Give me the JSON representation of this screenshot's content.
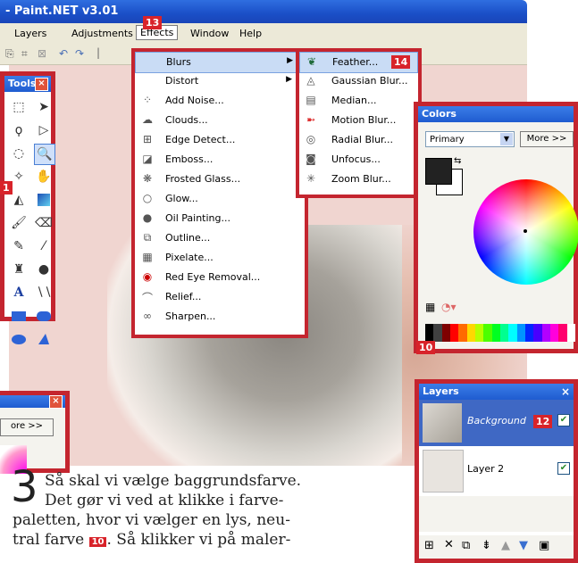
{
  "window": {
    "title": "- Paint.NET v3.01"
  },
  "menubar": {
    "layers": "Layers",
    "adjustments": "Adjustments",
    "effects": "Effects",
    "window": "Window",
    "help": "Help"
  },
  "badges": {
    "effects": "13",
    "feather": "14",
    "tools": "1",
    "colors": "10",
    "layers": "12",
    "inline": "10"
  },
  "tools": {
    "title": "Tools"
  },
  "effects_menu": {
    "items": [
      {
        "label": "Blurs",
        "icon": "blurs-icon",
        "submenu": true
      },
      {
        "label": "Distort",
        "icon": "",
        "submenu": true
      },
      {
        "label": "Add Noise...",
        "icon": "noise-icon"
      },
      {
        "label": "Clouds...",
        "icon": "clouds-icon"
      },
      {
        "label": "Edge Detect...",
        "icon": "edge-detect-icon"
      },
      {
        "label": "Emboss...",
        "icon": "emboss-icon"
      },
      {
        "label": "Frosted Glass...",
        "icon": "frosted-glass-icon"
      },
      {
        "label": "Glow...",
        "icon": "glow-icon"
      },
      {
        "label": "Oil Painting...",
        "icon": "oil-painting-icon"
      },
      {
        "label": "Outline...",
        "icon": "outline-icon"
      },
      {
        "label": "Pixelate...",
        "icon": "pixelate-icon"
      },
      {
        "label": "Red Eye Removal...",
        "icon": "red-eye-icon"
      },
      {
        "label": "Relief...",
        "icon": "relief-icon"
      },
      {
        "label": "Sharpen...",
        "icon": "sharpen-icon"
      }
    ]
  },
  "blurs_menu": {
    "items": [
      {
        "label": "Feather...",
        "icon": "feather-icon"
      },
      {
        "label": "Gaussian Blur...",
        "icon": "gaussian-blur-icon"
      },
      {
        "label": "Median...",
        "icon": "median-icon"
      },
      {
        "label": "Motion Blur...",
        "icon": "motion-blur-icon"
      },
      {
        "label": "Radial Blur...",
        "icon": "radial-blur-icon"
      },
      {
        "label": "Unfocus...",
        "icon": "unfocus-icon"
      },
      {
        "label": "Zoom Blur...",
        "icon": "zoom-blur-icon"
      }
    ]
  },
  "colors": {
    "title": "Colors",
    "mode": "Primary",
    "more": "More >>"
  },
  "second_colors": {
    "more": "ore >>"
  },
  "layers": {
    "title": "Layers",
    "items": [
      {
        "name": "Background",
        "visible": true
      },
      {
        "name": "Layer 2",
        "visible": true
      }
    ]
  },
  "article": {
    "step": "3",
    "lines": [
      "Så skal vi vælge baggrundsfarve.",
      "Det gør vi ved at klikke i farve-",
      "paletten, hvor vi vælger en lys, neu-",
      "tral farve",
      ". Så klikker vi på maler-"
    ]
  },
  "palette": [
    "#000000",
    "#404040",
    "#7f0000",
    "#ff0000",
    "#ff6a00",
    "#ffd800",
    "#b6ff00",
    "#4cff00",
    "#00ff21",
    "#00ff90",
    "#00ffff",
    "#0094ff",
    "#0026ff",
    "#4800ff",
    "#b200ff",
    "#ff00dc",
    "#ff006e",
    "#ffffff"
  ]
}
